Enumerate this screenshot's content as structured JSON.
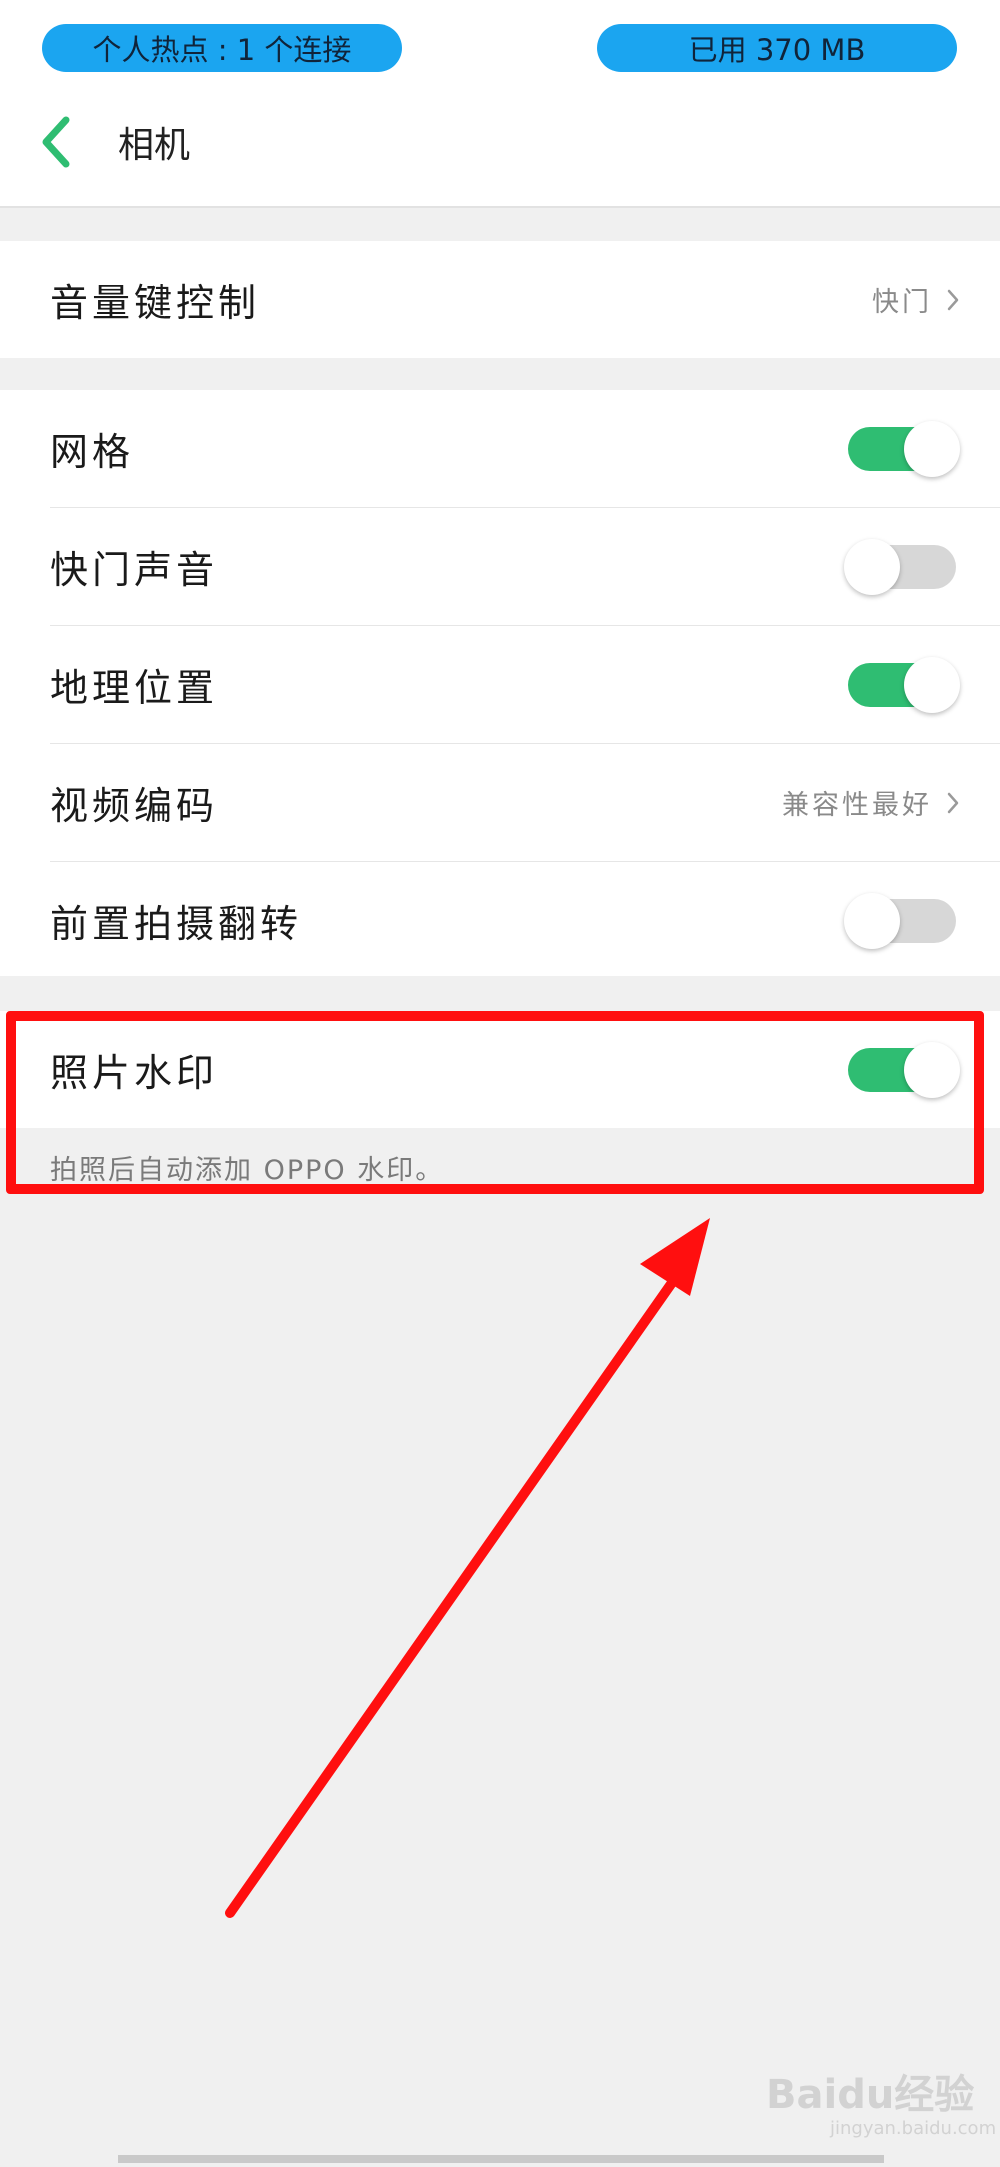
{
  "status_bar": {
    "hotspot": "个人热点 : 1 个连接",
    "data_used": "已用 370 MB"
  },
  "header": {
    "back_icon": "chevron-left-icon",
    "title": "相机"
  },
  "settings": {
    "volume_key": {
      "label": "音量键控制",
      "value": "快门"
    },
    "grid": {
      "label": "网格",
      "enabled": true
    },
    "shutter_sound": {
      "label": "快门声音",
      "enabled": false
    },
    "location": {
      "label": "地理位置",
      "enabled": true
    },
    "video_codec": {
      "label": "视频编码",
      "value": "兼容性最好"
    },
    "front_mirror": {
      "label": "前置拍摄翻转",
      "enabled": false
    },
    "photo_watermark": {
      "label": "照片水印",
      "enabled": true,
      "description": "拍照后自动添加 OPPO 水印。"
    }
  },
  "colors": {
    "accent_green": "#2fbd72",
    "status_pill": "#1ba5f0",
    "annotation_red": "#ff0f0f"
  },
  "watermark": {
    "logo": "Baidu经验",
    "url": "jingyan.baidu.com"
  }
}
